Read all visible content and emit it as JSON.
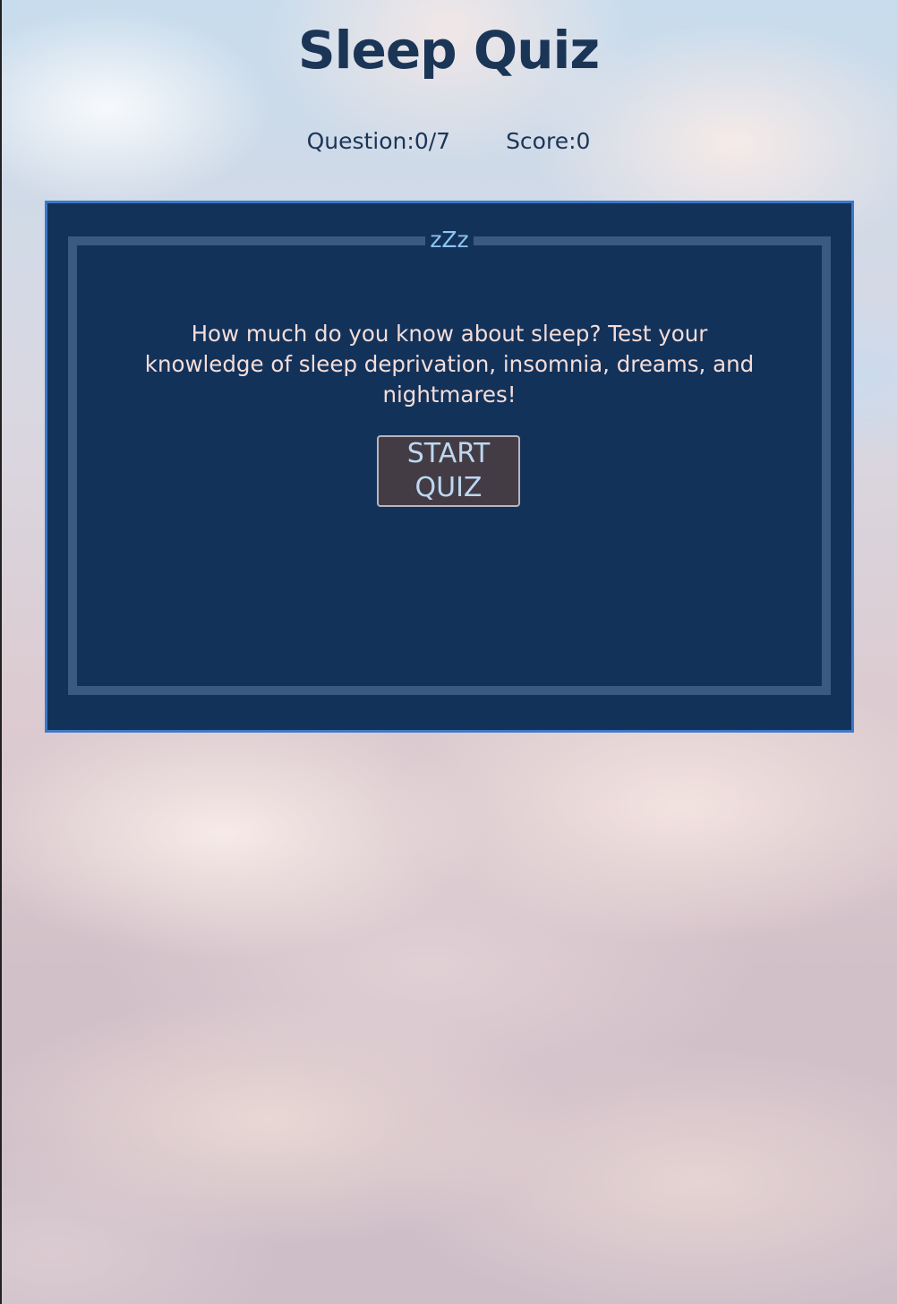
{
  "header": {
    "title": "Sleep Quiz"
  },
  "stats": {
    "question_label": "Question:",
    "question_value": "0/7",
    "score_label": "Score:",
    "score_value": "0"
  },
  "quiz_card": {
    "legend": "zZz",
    "intro_text": "How much do you know about sleep? Test your knowledge of sleep deprivation, insomnia, dreams, and nightmares!",
    "start_button_label": "START QUIZ"
  },
  "colors": {
    "title_text": "#1b3557",
    "card_background": "#13325a",
    "card_border": "#3b78c8",
    "frame_border": "#3b5a82",
    "legend_text": "#8ec5f2",
    "intro_text": "#f4ddd9",
    "button_background": "#443c44",
    "button_text": "#bcd8f2"
  },
  "background": {
    "description_icon": "cloudy-sky-image"
  }
}
